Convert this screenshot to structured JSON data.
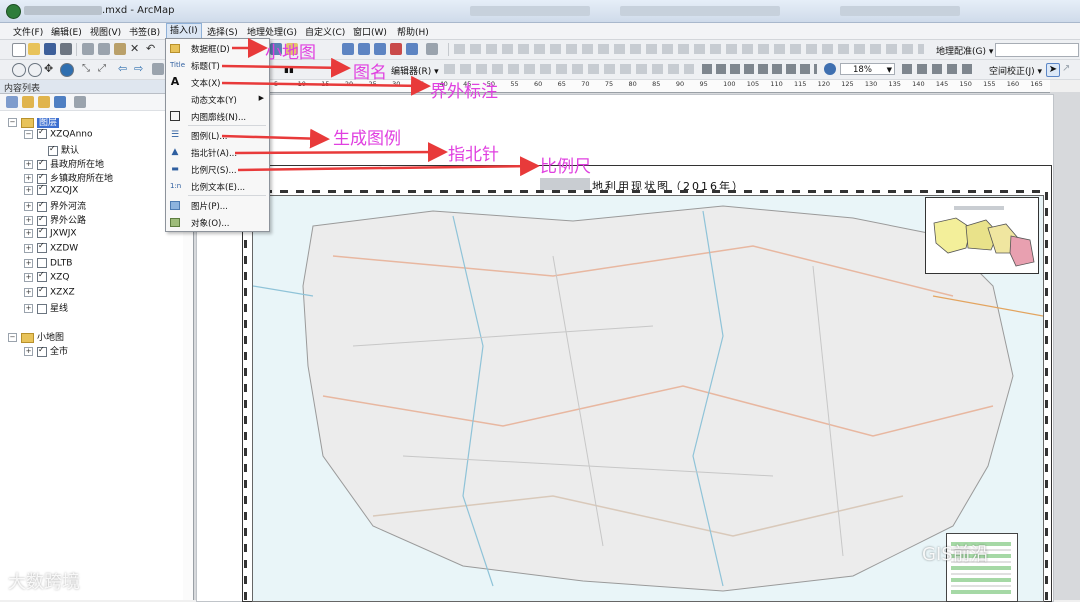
{
  "window": {
    "title_suffix": ".mxd - ArcMap"
  },
  "menubar": {
    "items": [
      "文件(F)",
      "编辑(E)",
      "视图(V)",
      "书签(B)",
      "插入(I)",
      "选择(S)",
      "地理处理(G)",
      "自定义(C)",
      "窗口(W)",
      "帮助(H)"
    ],
    "active": "插入(I)"
  },
  "toolbar": {
    "georef_label": "地理配准(G) ▾",
    "editor_label": "编辑器(R) ▾",
    "zoom_value": "18%",
    "spatial_adjust_label": "空间校正(J) ▾"
  },
  "insert_menu": {
    "items": [
      {
        "icon": "data-frame-icon",
        "label": "数据框(D)"
      },
      {
        "icon": "title-icon",
        "label": "标题(T)"
      },
      {
        "icon": "text-icon",
        "label": "文本(X)"
      },
      {
        "icon": "dynamic-text-icon",
        "label": "动态文本(Y)",
        "submenu": true
      },
      {
        "icon": "neatline-icon",
        "label": "内图廓线(N)..."
      },
      {
        "icon": "legend-icon",
        "label": "图例(L)..."
      },
      {
        "icon": "north-arrow-icon",
        "label": "指北针(A)..."
      },
      {
        "icon": "scale-bar-icon",
        "label": "比例尺(S)..."
      },
      {
        "icon": "scale-text-icon",
        "label": "比例文本(E)..."
      },
      {
        "icon": "picture-icon",
        "label": "图片(P)..."
      },
      {
        "icon": "object-icon",
        "label": "对象(O)..."
      }
    ]
  },
  "toc": {
    "header": "内容列表",
    "frames": [
      {
        "name": "图层",
        "layers": [
          {
            "name": "XZQAnno",
            "checked": true,
            "sub": [
              {
                "name": "默认",
                "checked": true
              }
            ]
          },
          {
            "name": "县政府所在地",
            "checked": true
          },
          {
            "name": "乡镇政府所在地",
            "checked": true
          },
          {
            "name": "XZQJX",
            "checked": true
          },
          {
            "name": "界外河流",
            "checked": true
          },
          {
            "name": "界外公路",
            "checked": true
          },
          {
            "name": "JXWJX",
            "checked": true
          },
          {
            "name": "XZDW",
            "checked": true
          },
          {
            "name": "DLTB",
            "checked": false
          },
          {
            "name": "XZQ",
            "checked": true
          },
          {
            "name": "XZXZ",
            "checked": true
          },
          {
            "name": "星线",
            "checked": false
          }
        ]
      },
      {
        "name": "小地图",
        "layers": [
          {
            "name": "全市",
            "checked": true
          }
        ]
      }
    ]
  },
  "ruler": {
    "ticks": [
      "5",
      "10",
      "15",
      "20",
      "25",
      "30",
      "35",
      "40",
      "45",
      "50",
      "55",
      "60",
      "65",
      "70",
      "75",
      "80",
      "85",
      "90",
      "95",
      "100",
      "105",
      "110",
      "115",
      "120",
      "125",
      "130",
      "135",
      "140",
      "145",
      "150",
      "155",
      "160",
      "165"
    ]
  },
  "map": {
    "title": "地利用现状图（2016年）"
  },
  "annotations": {
    "inset_map": "小地图",
    "map_title": "图名",
    "outer_label": "界外标注",
    "legend": "生成图例",
    "north_arrow": "指北针",
    "scale_bar": "比例尺"
  },
  "watermarks": {
    "left": "大数跨境",
    "right": "GIS前沿"
  },
  "colors": {
    "annotation": "#e040e0",
    "arrow": "#e83a3a",
    "map_background": "#e9f5f8"
  }
}
